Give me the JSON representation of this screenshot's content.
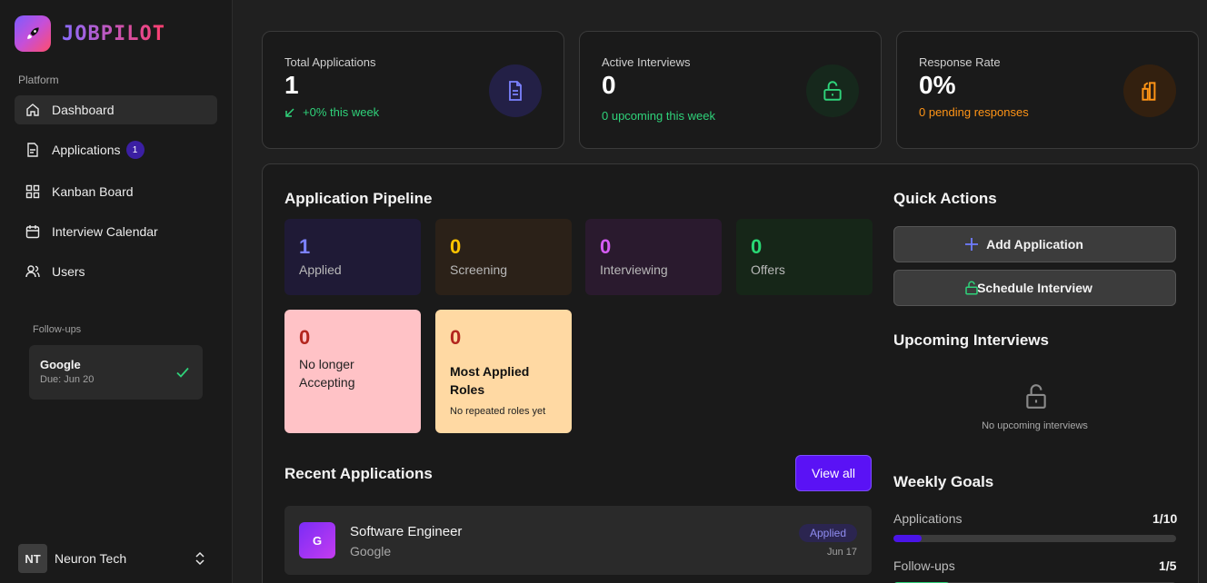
{
  "brand": {
    "name": "JOBPILOT"
  },
  "sidebar": {
    "section_label": "Platform",
    "items": [
      {
        "label": "Dashboard",
        "icon": "home-icon",
        "active": true
      },
      {
        "label": "Applications",
        "icon": "file-icon",
        "badge": "1"
      },
      {
        "label": "Kanban Board",
        "icon": "grid-icon"
      },
      {
        "label": "Interview Calendar",
        "icon": "calendar-icon"
      },
      {
        "label": "Users",
        "icon": "users-icon"
      }
    ],
    "followups_label": "Follow-ups",
    "followup": {
      "title": "Google",
      "due": "Due: Jun 20"
    },
    "user": {
      "initials": "NT",
      "name": "Neuron Tech"
    }
  },
  "stats": [
    {
      "title": "Total Applications",
      "value": "1",
      "sub": "+0% this week",
      "sub_color": "#2fd27a",
      "icon": "document-icon"
    },
    {
      "title": "Active Interviews",
      "value": "0",
      "sub": "0 upcoming this week",
      "sub_color": "#2fd27a",
      "icon": "lock-icon"
    },
    {
      "title": "Response Rate",
      "value": "0%",
      "sub": "0 pending responses",
      "sub_color": "#ff9416",
      "icon": "chart-icon"
    }
  ],
  "pipeline": {
    "title": "Application Pipeline",
    "stages": [
      {
        "count": "1",
        "label": "Applied",
        "color": "#7c82ff",
        "bg": "#1f1a36"
      },
      {
        "count": "0",
        "label": "Screening",
        "color": "#ffc400",
        "bg": "#2b2118"
      },
      {
        "count": "0",
        "label": "Interviewing",
        "color": "#d65cf5",
        "bg": "#2a1a2e"
      },
      {
        "count": "0",
        "label": "Offers",
        "color": "#29d874",
        "bg": "#162618"
      }
    ],
    "no_longer": {
      "count": "0",
      "label": "No longer Accepting"
    },
    "most_applied": {
      "count": "0",
      "title": "Most Applied Roles",
      "note": "No repeated roles yet"
    }
  },
  "recent": {
    "title": "Recent Applications",
    "view_all": "View all",
    "items": [
      {
        "initial": "G",
        "title": "Software Engineer",
        "company": "Google",
        "status": "Applied",
        "date": "Jun 17"
      }
    ]
  },
  "quick_actions": {
    "title": "Quick Actions",
    "add": "Add Application",
    "schedule": "Schedule Interview"
  },
  "upcoming": {
    "title": "Upcoming Interviews",
    "empty": "No upcoming interviews"
  },
  "goals": {
    "title": "Weekly Goals",
    "items": [
      {
        "label": "Applications",
        "value": "1/10",
        "progress": 0.1
      },
      {
        "label": "Follow-ups",
        "value": "1/5",
        "progress": 0.2
      }
    ]
  }
}
